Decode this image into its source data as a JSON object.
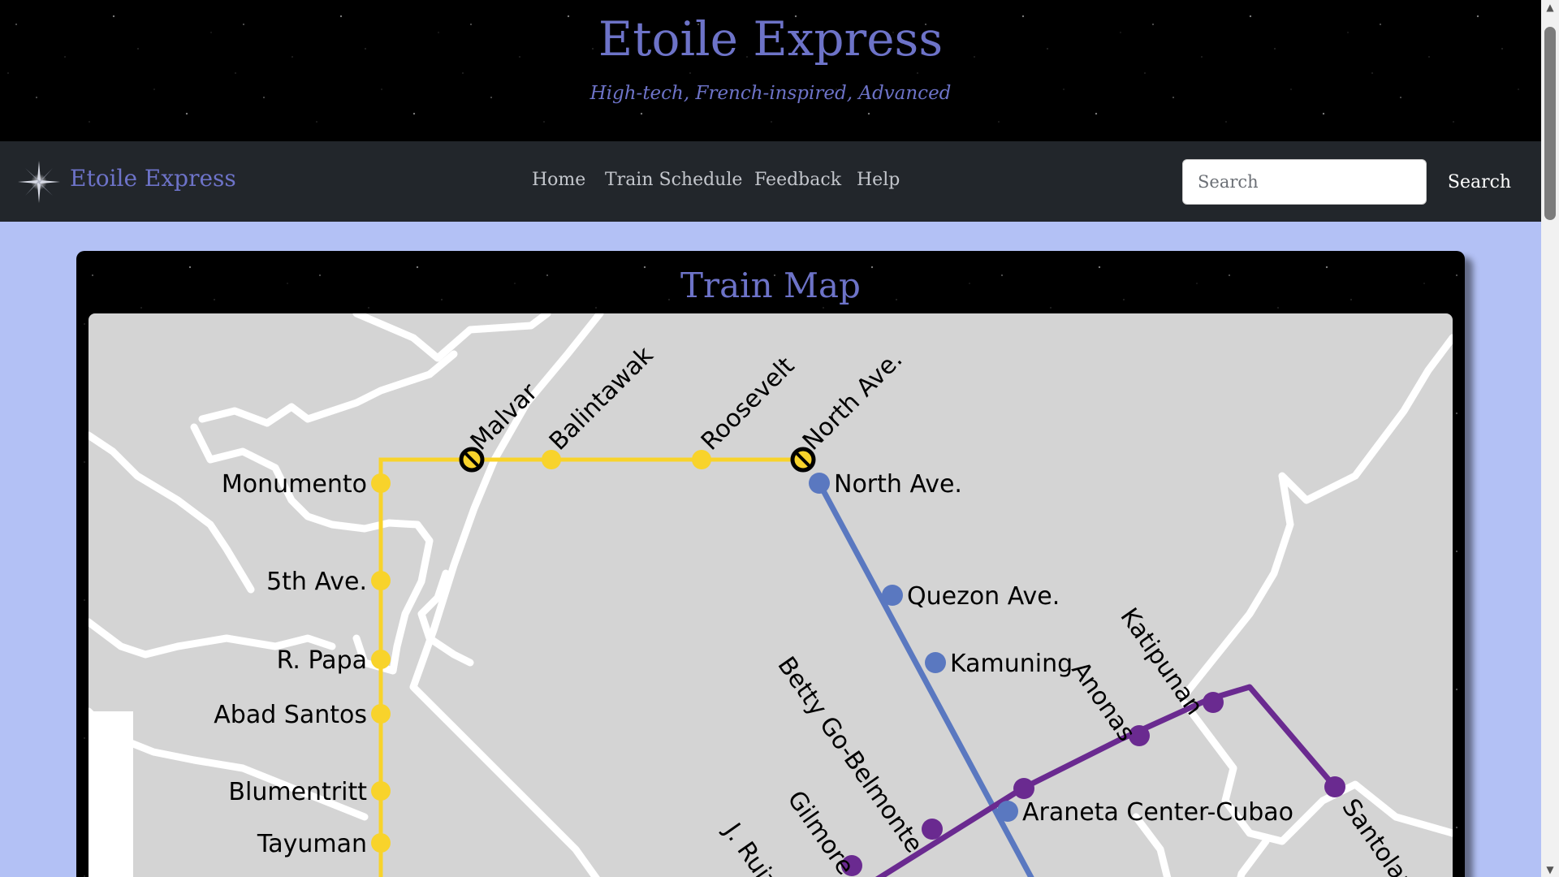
{
  "header": {
    "title": "Etoile Express",
    "tagline": "High-tech, French-inspired, Advanced"
  },
  "navbar": {
    "brand": "Etoile Express",
    "links": [
      "Home",
      "Train Schedule",
      "Feedback",
      "Help"
    ],
    "search_placeholder": "Search",
    "search_button": "Search"
  },
  "map": {
    "title": "Train Map",
    "lines": [
      {
        "name": "yellow",
        "color": "#f8d32b",
        "stations": [
          "Monumento",
          "5th Ave.",
          "R. Papa",
          "Abad Santos",
          "Blumentritt",
          "Tayuman",
          "Malvar",
          "Balintawak",
          "Roosevelt",
          "North Ave."
        ]
      },
      {
        "name": "blue",
        "color": "#5a78c0",
        "stations": [
          "North Ave.",
          "Quezon Ave.",
          "Kamuning",
          "Araneta Center-Cubao"
        ]
      },
      {
        "name": "purple",
        "color": "#6a2a90",
        "stations": [
          "J. Ruiz",
          "Gilmore",
          "Betty Go-Belmonte",
          "Araneta Center-Cubao",
          "Anonas",
          "Katipunan",
          "Santolan"
        ]
      }
    ],
    "labels": {
      "monumento": "Monumento",
      "fifth_ave": "5th Ave.",
      "r_papa": "R. Papa",
      "abad_santos": "Abad Santos",
      "blumentritt": "Blumentritt",
      "tayuman": "Tayuman",
      "malvar": "Malvar",
      "balintawak": "Balintawak",
      "roosevelt": "Roosevelt",
      "north_ave_yellow": "North Ave.",
      "north_ave_blue": "North Ave.",
      "quezon_ave": "Quezon Ave.",
      "kamuning": "Kamuning",
      "araneta": "Araneta Center-Cubao",
      "betty_go": "Betty Go-Belmonte",
      "gilmore": "Gilmore",
      "j_ruiz": "J. Ruiz",
      "anonas": "Anonas",
      "katipunan": "Katipunan",
      "santolan": "Santolan"
    }
  },
  "icons": {
    "brand": "star-icon",
    "closed_station": "closed-station-icon"
  },
  "colors": {
    "accent": "#6d73c8",
    "navbar": "#22262b",
    "page_background": "#b3c1f5",
    "map_background": "#d4d4d4"
  }
}
